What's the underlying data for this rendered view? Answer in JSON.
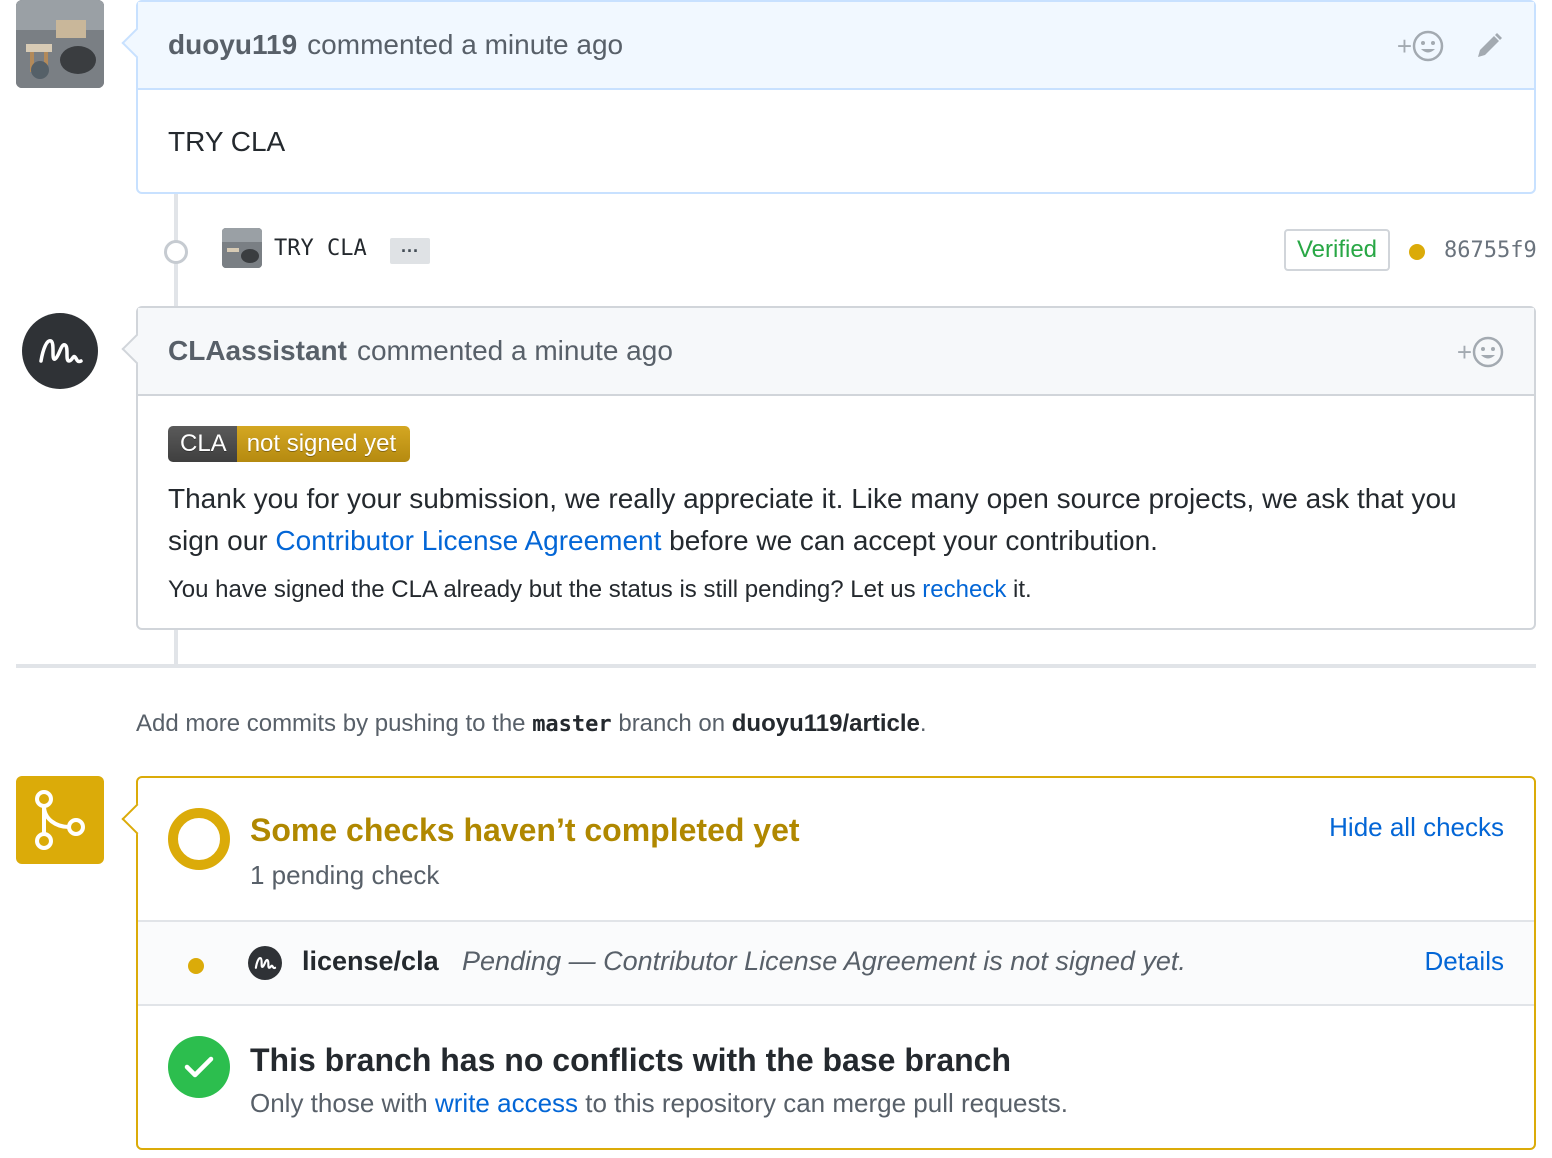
{
  "comment1": {
    "author": "duoyu119",
    "meta": "commented a minute ago",
    "body": "TRY CLA",
    "reaction_plus": "+"
  },
  "commit": {
    "message": "TRY CLA",
    "ellipsis": "···",
    "verified_label": "Verified",
    "sha": "86755f9",
    "status_color": "#dbab09"
  },
  "comment2": {
    "author": "CLAassistant",
    "meta": "commented a minute ago",
    "reaction_plus": "+",
    "badge_left": "CLA",
    "badge_right": "not signed yet",
    "text_before_link": "Thank you for your submission, we really appreciate it. Like many open source projects, we ask that you sign our ",
    "link_text": "Contributor License Agreement",
    "text_after_link": " before we can accept your contribution.",
    "small_before": "You have signed the CLA already but the status is still pending? Let us ",
    "small_link": "recheck",
    "small_after": " it."
  },
  "push_hint": {
    "prefix": "Add more commits by pushing to the ",
    "branch": "master",
    "middle": " branch on ",
    "repo": "duoyu119/article",
    "suffix": "."
  },
  "checks": {
    "title": "Some checks haven’t completed yet",
    "subtitle": "1 pending check",
    "toggle_label": "Hide all checks",
    "items": [
      {
        "name": "license/cla",
        "description": "Pending — Contributor License Agreement is not signed yet.",
        "details_label": "Details"
      }
    ]
  },
  "merge": {
    "title": "This branch has no conflicts with the base branch",
    "sub_before": "Only those with ",
    "sub_link": "write access",
    "sub_after": " to this repository can merge pull requests."
  },
  "colors": {
    "pending": "#dbab09",
    "success": "#2cbe4e",
    "link": "#0366d6"
  }
}
